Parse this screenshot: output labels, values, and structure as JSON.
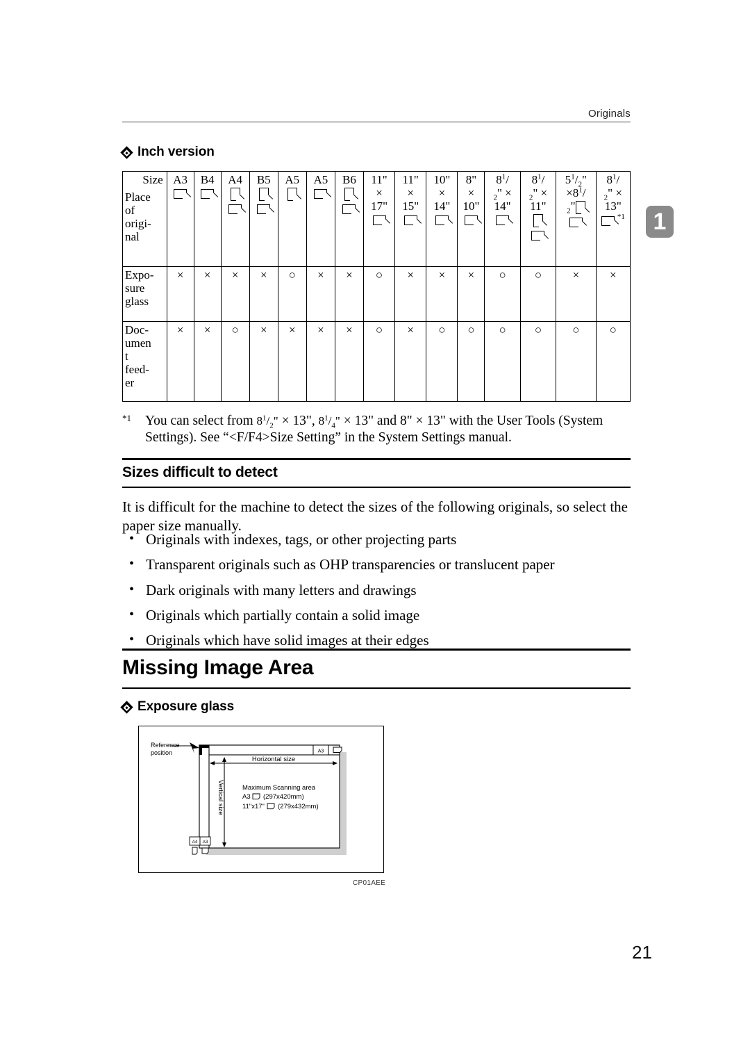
{
  "header": {
    "running_head": "Originals",
    "chapter_tab": "1"
  },
  "section_inch": {
    "heading": "Inch version"
  },
  "table": {
    "row_label_size": "Size",
    "row_label_place": "Place of original",
    "row_labels": [
      "Exposure glass",
      "Document feeder"
    ],
    "row_label_expo_lines": [
      "Expo-",
      "sure",
      "glass"
    ],
    "row_label_doc_lines": [
      "Doc-",
      "umen",
      "t",
      "feed-",
      "er"
    ],
    "columns": [
      {
        "label": "A3",
        "orientations": [
          "landscape"
        ],
        "note": ""
      },
      {
        "label": "B4",
        "orientations": [
          "landscape"
        ],
        "note": ""
      },
      {
        "label": "A4",
        "orientations": [
          "portrait",
          "landscape"
        ],
        "note": ""
      },
      {
        "label": "B5",
        "orientations": [
          "portrait",
          "landscape"
        ],
        "note": ""
      },
      {
        "label": "A5",
        "orientations": [
          "portrait"
        ],
        "note": ""
      },
      {
        "label": "A5",
        "orientations": [
          "landscape"
        ],
        "note": ""
      },
      {
        "label": "B6",
        "orientations": [
          "portrait",
          "landscape"
        ],
        "note": ""
      },
      {
        "label": "11\" × 17\"",
        "orientations": [
          "landscape"
        ],
        "note": ""
      },
      {
        "label": "11\" × 15\"",
        "orientations": [
          "landscape"
        ],
        "note": ""
      },
      {
        "label": "10\" × 14\"",
        "orientations": [
          "landscape"
        ],
        "note": ""
      },
      {
        "label": "8\" × 10\"",
        "orientations": [
          "landscape"
        ],
        "note": ""
      },
      {
        "label": "8 1/2\" × 14\"",
        "orientations": [
          "landscape"
        ],
        "note": ""
      },
      {
        "label": "8 1/2\" × 11\"",
        "orientations": [
          "portrait",
          "landscape"
        ],
        "note": ""
      },
      {
        "label": "5 1/2\" × 8 1/2\"",
        "orientations": [
          "portrait",
          "landscape"
        ],
        "note": ""
      },
      {
        "label": "8 1/2\" × 13\"",
        "orientations": [
          "landscape"
        ],
        "note": "*1"
      }
    ],
    "exposure_glass": [
      "×",
      "×",
      "×",
      "×",
      "○",
      "×",
      "×",
      "○",
      "×",
      "×",
      "×",
      "○",
      "○",
      "×",
      "×"
    ],
    "document_feeder": [
      "×",
      "×",
      "○",
      "×",
      "×",
      "×",
      "×",
      "○",
      "×",
      "○",
      "○",
      "○",
      "○",
      "○",
      "○"
    ]
  },
  "footnote": {
    "marker": "*1",
    "text": "You can select from 8 1/2\" × 13\", 8 1/4\" × 13\" and 8\" × 13\" with the User Tools (System Settings). See “<F/F4>Size Setting” in the System Settings manual."
  },
  "sizes_section": {
    "heading": "Sizes difficult to detect",
    "intro": "It is difficult for the machine to detect the sizes of the following originals, so select the paper size manually.",
    "bullets": [
      "Originals with indexes, tags, or other projecting parts",
      "Transparent originals such as OHP transparencies or translucent paper",
      "Dark originals with many letters and drawings",
      "Originals which partially contain a solid image",
      "Originals which have solid images at their edges"
    ]
  },
  "missing_image_area": {
    "heading": "Missing Image Area",
    "subheading": "Exposure glass"
  },
  "figure": {
    "reference_position": "Reference position",
    "horizontal_size": "Horizontal size",
    "vertical_size": "Vertical size",
    "max_area_title": "Maximum Scanning area",
    "max_area_line1": "A3 ⬜ (297x420mm)",
    "max_area_line2": "11\"x17\" ⬜ (279x432mm)",
    "max_area_a3": "A3",
    "max_area_a3_dims": "(297x420mm)",
    "max_area_inch": "11\"x17\"",
    "max_area_inch_dims": "(279x432mm)",
    "tag_a3_top": "A3",
    "tag_a4": "A4",
    "tag_a3": "A3",
    "code": "CP01AEE"
  },
  "page_number": "21",
  "colors": {
    "tab_gray": "#8a8a8a",
    "fig_shadow": "#d0d0d0",
    "rule": "#000000"
  }
}
